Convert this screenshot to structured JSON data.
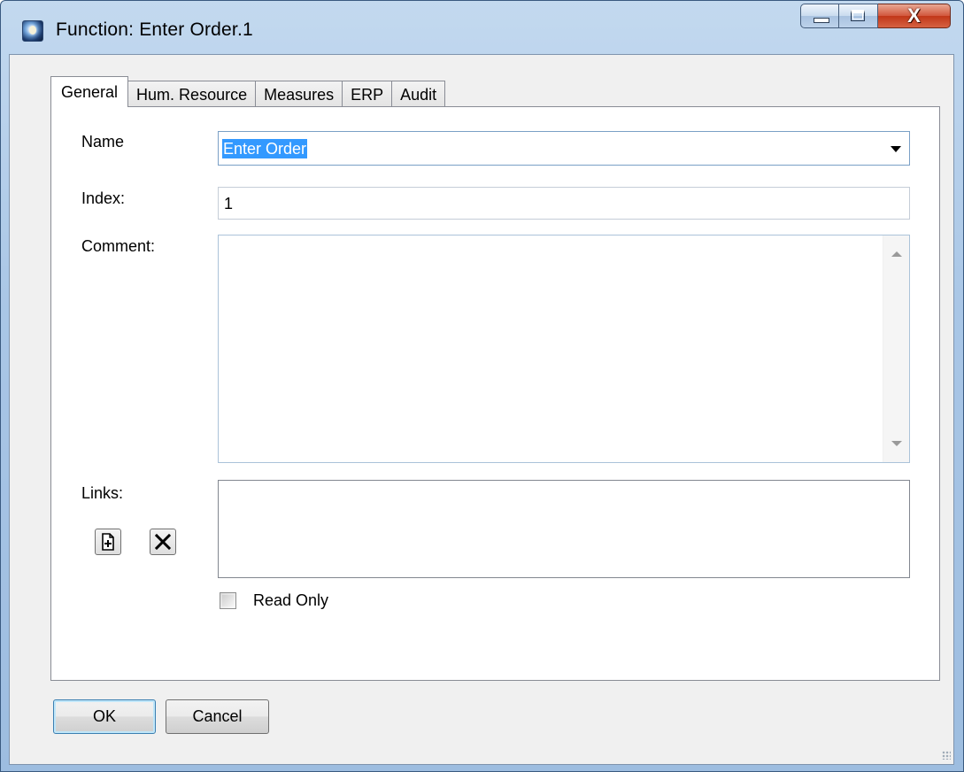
{
  "window": {
    "title": "Function: Enter Order.1",
    "icon": "app-globe-icon",
    "controls": {
      "minimize": "minimize-icon",
      "maximize": "maximize-icon",
      "close_glyph": "X"
    }
  },
  "tabs": [
    {
      "label": "General",
      "active": true
    },
    {
      "label": "Hum. Resource",
      "active": false
    },
    {
      "label": "Measures",
      "active": false
    },
    {
      "label": "ERP",
      "active": false
    },
    {
      "label": "Audit",
      "active": false
    }
  ],
  "general": {
    "name_label": "Name",
    "name_value": "Enter Order",
    "index_label": "Index:",
    "index_value": "1",
    "comment_label": "Comment:",
    "comment_value": "",
    "links_label": "Links:",
    "read_only_label": "Read Only",
    "read_only_checked": false
  },
  "buttons": {
    "ok": "OK",
    "cancel": "Cancel"
  },
  "colors": {
    "selection": "#3399ff",
    "window_frame": "#a9c6e6",
    "close_button": "#c13718"
  }
}
